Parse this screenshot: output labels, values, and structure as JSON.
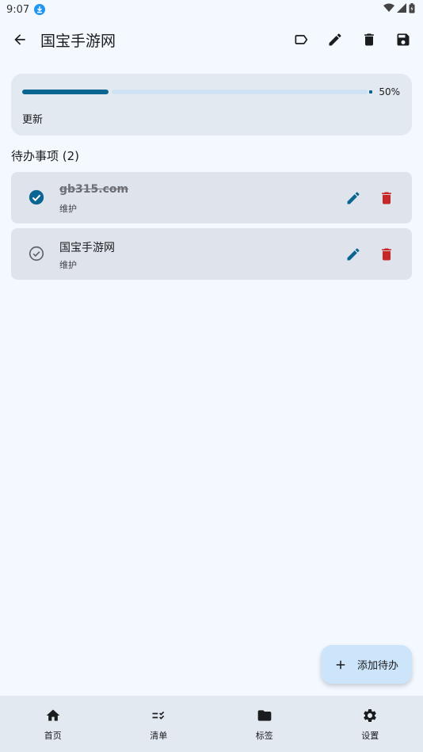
{
  "status_bar": {
    "time": "9:07"
  },
  "app_bar": {
    "title": "国宝手游网",
    "actions": [
      "label-icon",
      "edit-icon",
      "delete-icon",
      "save-icon"
    ]
  },
  "progress": {
    "value": 0.5,
    "percent_text": "50%",
    "label": "更新"
  },
  "section": {
    "title": "待办事项 (2)"
  },
  "todos": [
    {
      "title": "gb315.com",
      "tag": "维护",
      "completed": true
    },
    {
      "title": "国宝手游网",
      "tag": "维护",
      "completed": false
    }
  ],
  "fab": {
    "label": "添加待办"
  },
  "bottom_nav": {
    "items": [
      {
        "label": "首页",
        "icon": "home-icon"
      },
      {
        "label": "清单",
        "icon": "checklist-icon"
      },
      {
        "label": "标签",
        "icon": "folder-icon"
      },
      {
        "label": "设置",
        "icon": "settings-icon"
      }
    ]
  },
  "colors": {
    "primary": "#0b6592",
    "delete": "#c62828",
    "card_bg": "#dfe3eb",
    "background": "#f3f9ff",
    "fab_bg": "#cde5fb"
  }
}
